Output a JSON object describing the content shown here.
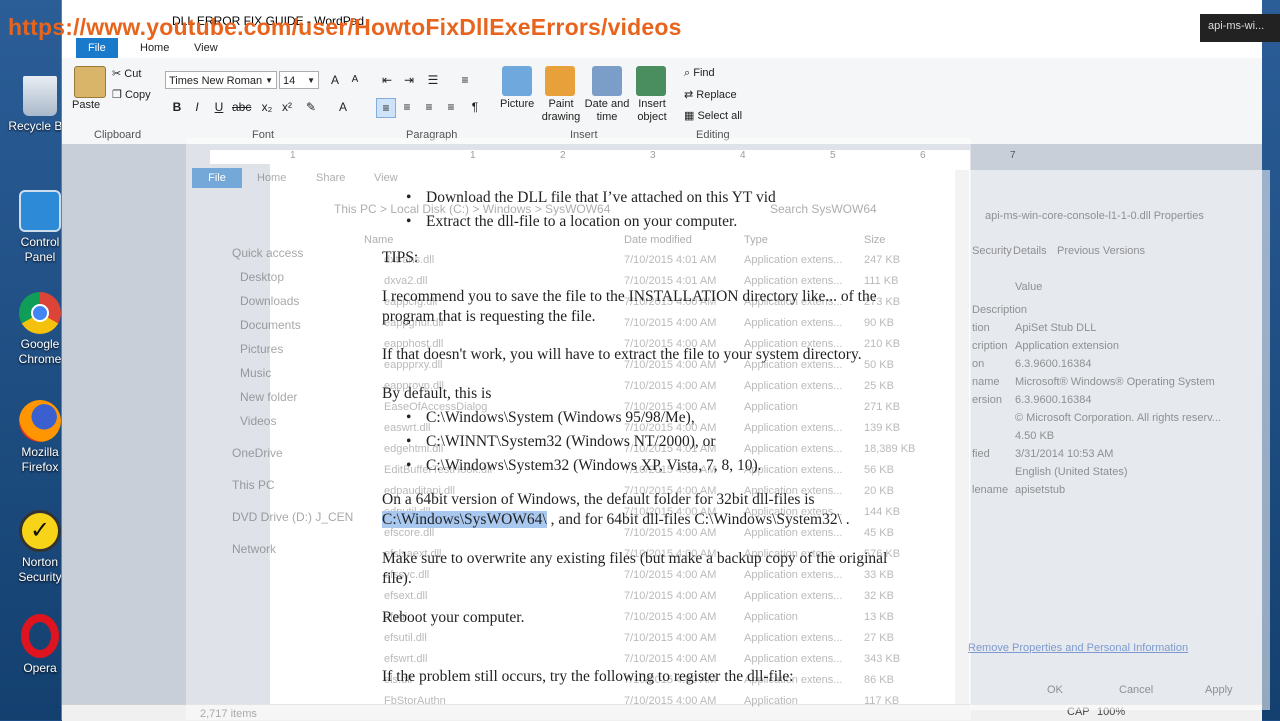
{
  "overlay_url": "https://www.youtube.com/user/HowtoFixDllExeErrors/videos",
  "window_title": "DLL ERROR FIX GUIDE - WordPad",
  "desktop_icons": [
    {
      "label": "Recycle Bin",
      "icon": "recycle-bin-icon"
    },
    {
      "label": "Control Panel",
      "icon": "control-panel-icon"
    },
    {
      "label": "Google Chrome",
      "icon": "chrome-icon"
    },
    {
      "label": "Mozilla Firefox",
      "icon": "firefox-icon"
    },
    {
      "label": "Norton Security",
      "icon": "norton-icon"
    },
    {
      "label": "Opera",
      "icon": "opera-icon"
    }
  ],
  "desktop_folder_label": "New folder",
  "tabs": {
    "file": "File",
    "home": "Home",
    "view": "View"
  },
  "ribbon": {
    "paste": "Paste",
    "cut": "Cut",
    "copy": "Copy",
    "clipboard_label": "Clipboard",
    "font_name": "Times New Roman",
    "font_size": "14",
    "font_label": "Font",
    "paragraph_label": "Paragraph",
    "picture": "Picture",
    "paint_drawing": "Paint drawing",
    "date_time": "Date and time",
    "insert_object": "Insert object",
    "insert_label": "Insert",
    "find": "Find",
    "replace": "Replace",
    "select_all": "Select all",
    "editing_label": "Editing"
  },
  "document": {
    "bullet1": "Download the DLL file that I’ve attached on this YT vid",
    "bullet2": "Extract the dll-file  to a location on your computer.",
    "tips": "TIPS:",
    "p1": "I recommend you to save the file to the INSTALLATION directory like... of the program that is requesting the file.",
    "p2": "If that doesn't work, you will have to extract the file to your system directory.",
    "p3": "By default, this is",
    "b3": "C:\\Windows\\System (Windows 95/98/Me),",
    "b4": "C:\\WINNT\\System32 (Windows NT/2000), or",
    "b5": "C:\\Windows\\System32 (Windows XP, Vista, 7, 8, 10).",
    "p4_a": "On a 64bit version of Windows, the default folder for 32bit dll-files  is ",
    "p4_hl": "C:\\Windows\\SysWOW64\\",
    "p4_b": " , and for 64bit dll-files  C:\\Windows\\System32\\ .",
    "p5": "Make sure to overwrite any existing  files (but make a backup copy of the original file).",
    "p6": "Reboot your computer.",
    "p7": "If the problem still  occurs, try the following to register the dll-file:"
  },
  "explorer": {
    "file_tab": "File",
    "home_tab": "Home",
    "share_tab": "Share",
    "view_tab": "View",
    "path": "This PC  >  Local Disk (C:)  >  Windows  >  SysWOW64",
    "search": "Search SysWOW64",
    "nav": [
      "Quick access",
      "Desktop",
      "Downloads",
      "Documents",
      "Pictures",
      "Music",
      "New folder",
      "Videos",
      "OneDrive",
      "This PC",
      "DVD Drive (D:) J_CEN",
      "Network"
    ],
    "columns": {
      "name": "Name",
      "date": "Date modified",
      "type": "Type",
      "size": "Size"
    },
    "rows": [
      {
        "name": "dxtrans.dll",
        "date": "7/10/2015 4:01 AM",
        "type": "Application extens...",
        "size": "247 KB"
      },
      {
        "name": "dxva2.dll",
        "date": "7/10/2015 4:01 AM",
        "type": "Application extens...",
        "size": "111 KB"
      },
      {
        "name": "eappcfg.dll",
        "date": "7/10/2015 4:00 AM",
        "type": "Application extens...",
        "size": "273 KB"
      },
      {
        "name": "eappgnui.dll",
        "date": "7/10/2015 4:00 AM",
        "type": "Application extens...",
        "size": "90 KB"
      },
      {
        "name": "eapphost.dll",
        "date": "7/10/2015 4:00 AM",
        "type": "Application extens...",
        "size": "210 KB"
      },
      {
        "name": "eappprxy.dll",
        "date": "7/10/2015 4:00 AM",
        "type": "Application extens...",
        "size": "50 KB"
      },
      {
        "name": "eapprovp.dll",
        "date": "7/10/2015 4:00 AM",
        "type": "Application extens...",
        "size": "25 KB"
      },
      {
        "name": "EaseOfAccessDialog",
        "date": "7/10/2015 4:00 AM",
        "type": "Application",
        "size": "271 KB"
      },
      {
        "name": "easwrt.dll",
        "date": "7/10/2015 4:00 AM",
        "type": "Application extens...",
        "size": "139 KB"
      },
      {
        "name": "edgehtml.dll",
        "date": "7/10/2015 4:01 AM",
        "type": "Application extens...",
        "size": "18,389 KB"
      },
      {
        "name": "EditBufferTestHook.dll",
        "date": "7/10/2015 4:00 AM",
        "type": "Application extens...",
        "size": "56 KB"
      },
      {
        "name": "edpauditapi.dll",
        "date": "7/10/2015 4:00 AM",
        "type": "Application extens...",
        "size": "20 KB"
      },
      {
        "name": "edputil.dll",
        "date": "7/10/2015 4:00 AM",
        "type": "Application extens...",
        "size": "144 KB"
      },
      {
        "name": "efscore.dll",
        "date": "7/10/2015 4:00 AM",
        "type": "Application extens...",
        "size": "45 KB"
      },
      {
        "name": "efslsaext.dll",
        "date": "7/10/2015 4:00 AM",
        "type": "Application extens...",
        "size": "576 KB"
      },
      {
        "name": "efssvc.dll",
        "date": "7/10/2015 4:00 AM",
        "type": "Application extens...",
        "size": "33 KB"
      },
      {
        "name": "efsext.dll",
        "date": "7/10/2015 4:00 AM",
        "type": "Application extens...",
        "size": "32 KB"
      },
      {
        "name": "efsui",
        "date": "7/10/2015 4:00 AM",
        "type": "Application",
        "size": "13 KB"
      },
      {
        "name": "efsutil.dll",
        "date": "7/10/2015 4:00 AM",
        "type": "Application extens...",
        "size": "27 KB"
      },
      {
        "name": "efswrt.dll",
        "date": "7/10/2015 4:00 AM",
        "type": "Application extens...",
        "size": "343 KB"
      },
      {
        "name": "els.dll",
        "date": "7/10/2015 4:00 AM",
        "type": "Application extens...",
        "size": "86 KB"
      },
      {
        "name": "FbStorAuthn",
        "date": "7/10/2015 4:00 AM",
        "type": "Application",
        "size": "117 KB"
      }
    ],
    "item_count": "2,717 items"
  },
  "properties": {
    "title": "api-ms-win-core-console-l1-1-0.dll Properties",
    "tabs": [
      "Security",
      "Details",
      "Previous Versions"
    ],
    "value_header": "Value",
    "labels": [
      "Description",
      "tion",
      "cription",
      "on",
      "name",
      "ersion",
      "",
      "",
      "fied",
      "",
      "lename"
    ],
    "values": [
      "ApiSet Stub DLL",
      "Application extension",
      "6.3.9600.16384",
      "Microsoft® Windows® Operating System",
      "6.3.9600.16384",
      "© Microsoft Corporation. All rights reserv...",
      "4.50 KB",
      "3/31/2014 10:53 AM",
      "English (United States)",
      "apisetstub"
    ],
    "link": "Remove Properties and Personal Information",
    "ok": "OK",
    "cancel": "Cancel",
    "apply": "Apply"
  },
  "status": {
    "cap": "CAP",
    "zoom": "100%"
  },
  "taskbar_right": "api-ms-wi..."
}
